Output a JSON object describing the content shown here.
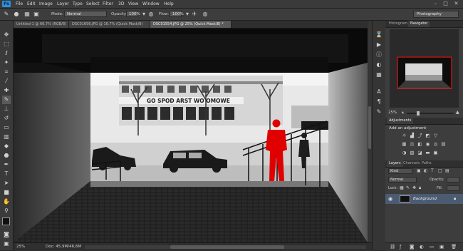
{
  "app": {
    "logo": "Ps"
  },
  "menu": [
    "File",
    "Edit",
    "Image",
    "Layer",
    "Type",
    "Select",
    "Filter",
    "3D",
    "View",
    "Window",
    "Help"
  ],
  "window_controls": [
    "–",
    "□",
    "✕"
  ],
  "options": {
    "mode_label": "Mode:",
    "mode_value": "Normal",
    "opacity_label": "Opacity:",
    "opacity_value": "100%",
    "flow_label": "Flow:",
    "flow_value": "100%",
    "workspace": "Photography"
  },
  "tabs": [
    {
      "label": "Untitled-1 @ 66.7% (RGB/8)"
    },
    {
      "label": "DSC01656.JPG @ 16.7% (Quick Mask/8)"
    },
    {
      "label": "DSC01554.JPG @ 25% (Quick Mask/8) *"
    }
  ],
  "status": {
    "zoom": "25%",
    "doc": "Doc: 45,9M/46,6M"
  },
  "photo": {
    "shop_sign": "GO SPOD ARST WO OMOWE"
  },
  "navigator": {
    "tabs": [
      "Histogram",
      "Navigator"
    ],
    "zoom": "25%"
  },
  "adjustments": {
    "tabs": [
      "Adjustments"
    ],
    "heading": "Add an adjustment"
  },
  "layers": {
    "tabs": [
      "Layers",
      "Channels",
      "Paths"
    ],
    "kind": "Kind",
    "blend": "Normal",
    "opacity_label": "Opacity:",
    "lock_label": "Lock:",
    "fill_label": "Fill:",
    "layer_name": "Background"
  },
  "colors": {
    "accent": "#2d8fdc",
    "mask_red": "#e00000",
    "nav_frame": "#e02020"
  },
  "icons": {
    "tools": [
      "move-icon",
      "marquee-icon",
      "lasso-icon",
      "quick-select-icon",
      "crop-icon",
      "eyedropper-icon",
      "healing-icon",
      "brush-icon",
      "clone-stamp-icon",
      "history-brush-icon",
      "eraser-icon",
      "gradient-icon",
      "blur-icon",
      "dodge-icon",
      "pen-icon",
      "type-icon",
      "path-select-icon",
      "shape-icon",
      "hand-icon",
      "zoom-icon"
    ]
  }
}
